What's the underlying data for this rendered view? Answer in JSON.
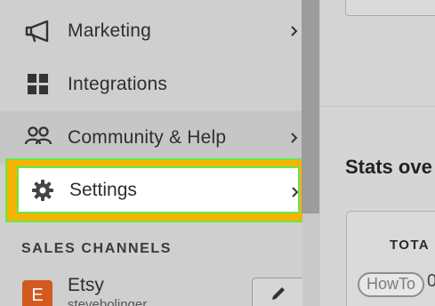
{
  "sidebar": {
    "items": [
      {
        "label": "Marketing",
        "icon": "megaphone-icon"
      },
      {
        "label": "Integrations",
        "icon": "grid-icon"
      },
      {
        "label": "Community & Help",
        "icon": "people-icon"
      },
      {
        "label": "Settings",
        "icon": "gear-icon"
      }
    ],
    "section_header": "SALES CHANNELS",
    "channel": {
      "badge": "E",
      "name": "Etsy",
      "subtitle": "stevebolinger",
      "edit_icon": "pencil-icon"
    }
  },
  "main": {
    "stats_title": "Stats ove",
    "stats_label": "TOTA",
    "stats_value": "0"
  },
  "watermark": "HowTo",
  "colors": {
    "highlight": "#f5b400",
    "highlight_border": "#64e84a",
    "etsy_badge": "#d2591f"
  }
}
